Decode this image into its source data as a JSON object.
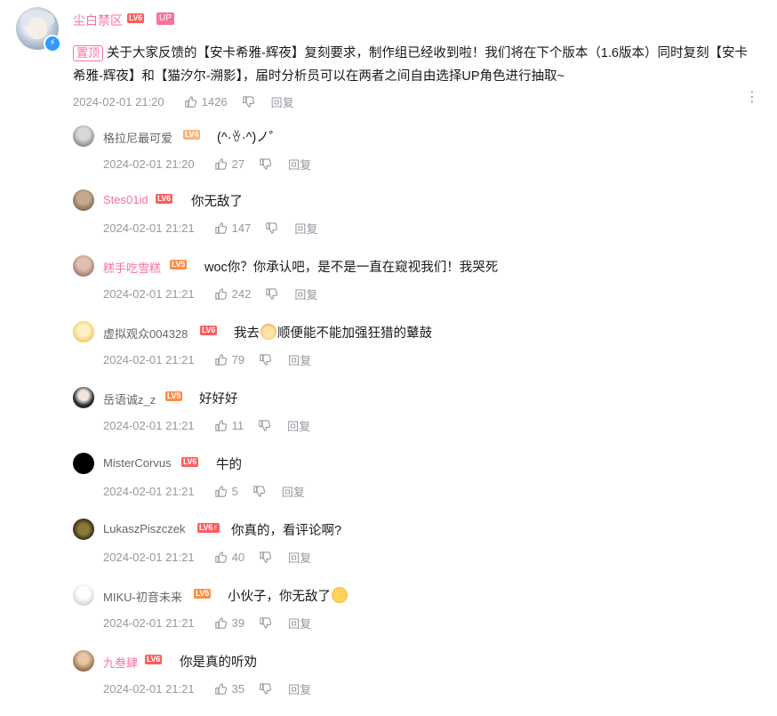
{
  "root": {
    "username": "尘白禁区",
    "level": "LV6",
    "up_tag": "UP",
    "pin_label": "置顶",
    "text": "关于大家反馈的【安卡希雅-辉夜】复刻要求，制作组已经收到啦！我们将在下个版本（1.6版本）同时复刻【安卡希雅-辉夜】和【猫汐尔-溯影】，届时分析员可以在两者之间自由选择UP角色进行抽取~",
    "time": "2024-02-01 21:20",
    "likes": "1426",
    "reply_label": "回复",
    "more_icon": "⋮"
  },
  "replies": [
    {
      "username": "格拉尼最可爱",
      "level": "LV4",
      "content": "(^·ꈊ·^)ノ˚",
      "time": "2024-02-01 21:20",
      "likes": "27",
      "reply_label": "回复",
      "name_color": "#61666d"
    },
    {
      "username": "Stes01id",
      "level": "LV6",
      "content": "你无敌了",
      "time": "2024-02-01 21:21",
      "likes": "147",
      "reply_label": "回复",
      "name_color": "#fb7299"
    },
    {
      "username": "糕手吃雪糕",
      "level": "LV5",
      "content": "woc你？你承认吧，是不是一直在窥视我们！我哭死",
      "time": "2024-02-01 21:21",
      "likes": "242",
      "reply_label": "回复",
      "name_color": "#fb7299"
    },
    {
      "username": "虚拟观众004328",
      "level": "LV6",
      "content_before": "我去",
      "content_after": "顺便能不能加强狂猎的鼙鼓",
      "time": "2024-02-01 21:21",
      "likes": "79",
      "reply_label": "回复",
      "name_color": "#61666d"
    },
    {
      "username": "岳语诚z_z",
      "level": "LV5",
      "content": "好好好",
      "time": "2024-02-01 21:21",
      "likes": "11",
      "reply_label": "回复",
      "name_color": "#61666d"
    },
    {
      "username": "MisterCorvus",
      "level": "LV6",
      "content": "牛的",
      "time": "2024-02-01 21:21",
      "likes": "5",
      "reply_label": "回复",
      "name_color": "#61666d"
    },
    {
      "username": "LukaszPiszczek",
      "level": "LV6⚡",
      "content": "你真的，看评论啊?",
      "time": "2024-02-01 21:21",
      "likes": "40",
      "reply_label": "回复",
      "name_color": "#61666d"
    },
    {
      "username": "MIKU-初音未来",
      "level": "LV5",
      "content_before": "小伙子，你无敌了",
      "content_after": "",
      "time": "2024-02-01 21:21",
      "likes": "39",
      "reply_label": "回复",
      "name_color": "#61666d"
    },
    {
      "username": "九叁肆",
      "level": "LV6",
      "content": "你是真的听劝",
      "time": "2024-02-01 21:21",
      "likes": "35",
      "reply_label": "回复",
      "name_color": "#fb7299"
    }
  ],
  "colors": {
    "accent": "#fb7299",
    "meta": "#9499a0",
    "verified": "#2f9bff"
  }
}
